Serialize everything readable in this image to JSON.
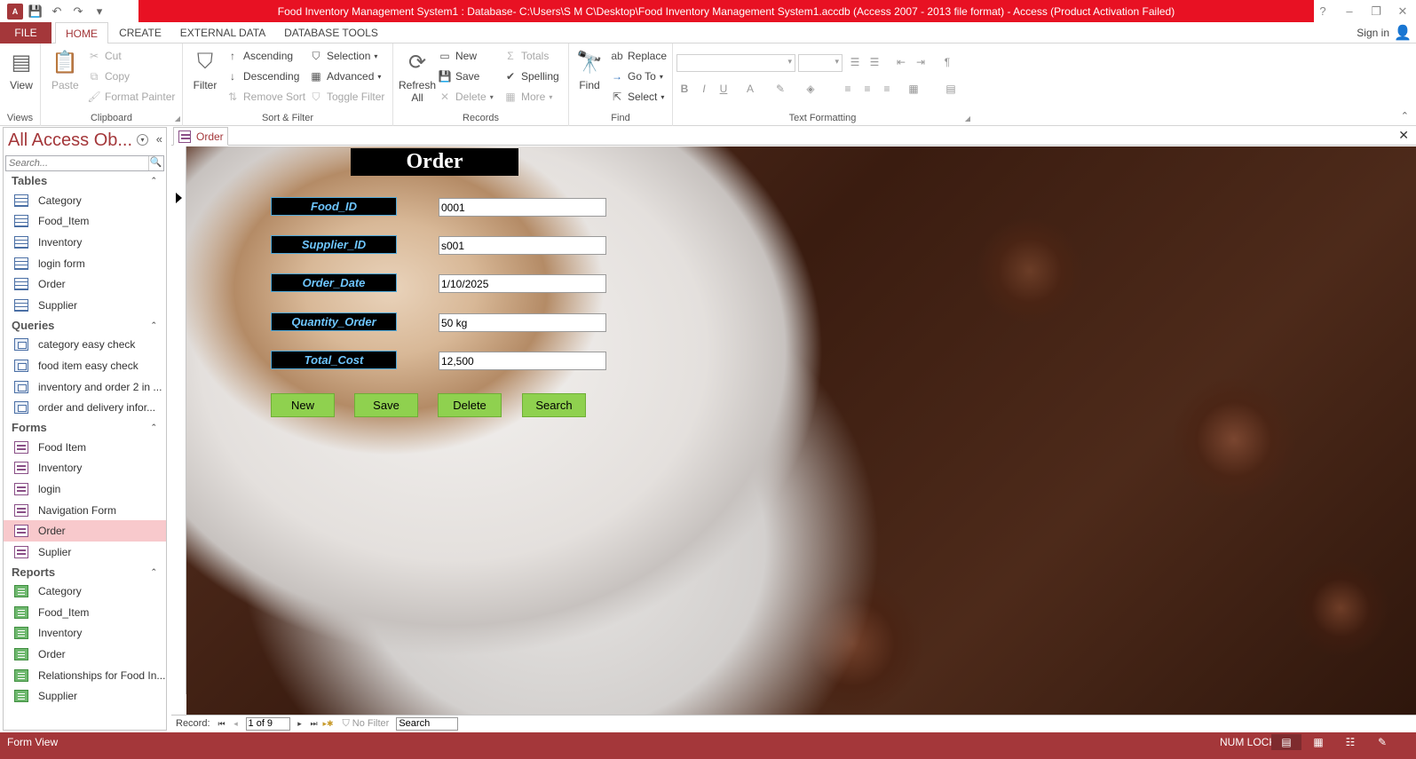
{
  "window": {
    "title": "Food Inventory Management System1 : Database- C:\\Users\\S M C\\Desktop\\Food Inventory Management System1.accdb (Access 2007 - 2013 file format) - Access (Product Activation Failed)",
    "app_logo_text": "A",
    "controls": {
      "help": "?",
      "minimize": "–",
      "restore": "❐",
      "close": "✕"
    }
  },
  "ribbon_tabs": {
    "file": "FILE",
    "home": "HOME",
    "create": "CREATE",
    "external_data": "EXTERNAL DATA",
    "database_tools": "DATABASE TOOLS",
    "sign_in": "Sign in"
  },
  "ribbon": {
    "views": {
      "label": "Views",
      "view": "View"
    },
    "clipboard": {
      "label": "Clipboard",
      "paste": "Paste",
      "cut": "Cut",
      "copy": "Copy",
      "format_painter": "Format Painter"
    },
    "sort_filter": {
      "label": "Sort & Filter",
      "filter": "Filter",
      "ascending": "Ascending",
      "descending": "Descending",
      "remove_sort": "Remove Sort",
      "selection": "Selection",
      "advanced": "Advanced",
      "toggle_filter": "Toggle Filter"
    },
    "records": {
      "label": "Records",
      "refresh": "Refresh",
      "refresh_all": "All",
      "new": "New",
      "save": "Save",
      "delete": "Delete",
      "totals": "Totals",
      "spelling": "Spelling",
      "more": "More"
    },
    "find": {
      "label": "Find",
      "find": "Find",
      "replace": "Replace",
      "go_to": "Go To",
      "select": "Select"
    },
    "text_formatting": {
      "label": "Text Formatting",
      "bold": "B",
      "italic": "I",
      "underline": "U",
      "font_color": "A"
    }
  },
  "nav_pane": {
    "title": "All Access Ob...",
    "search_placeholder": "Search...",
    "categories": [
      {
        "name": "Tables",
        "icon": "table",
        "items": [
          "Category",
          "Food_Item",
          "Inventory",
          "login form",
          "Order",
          "Supplier"
        ]
      },
      {
        "name": "Queries",
        "icon": "query",
        "items": [
          "category easy check",
          "food item easy check",
          "inventory and order 2 in ...",
          "order and delivery infor..."
        ]
      },
      {
        "name": "Forms",
        "icon": "form",
        "items": [
          "Food Item",
          "Inventory",
          "login",
          "Navigation Form",
          "Order",
          "Suplier"
        ]
      },
      {
        "name": "Reports",
        "icon": "report",
        "items": [
          "Category",
          "Food_Item",
          "Inventory",
          "Order",
          "Relationships for Food In...",
          "Supplier"
        ]
      }
    ],
    "selected": {
      "category": "Forms",
      "item": "Order"
    }
  },
  "document_tab": {
    "label": "Order"
  },
  "form": {
    "title": "Order",
    "fields": [
      {
        "label": "Food_ID",
        "value": "0001"
      },
      {
        "label": "Supplier_ID",
        "value": "s001"
      },
      {
        "label": "Order_Date",
        "value": "1/10/2025"
      },
      {
        "label": "Quantity_Order",
        "value": "50 kg"
      },
      {
        "label": "Total_Cost",
        "value": "12,500"
      }
    ],
    "buttons": {
      "new": "New",
      "save": "Save",
      "delete": "Delete",
      "search": "Search"
    },
    "label_color": "#6ec6ff",
    "button_color": "#8fd14f"
  },
  "record_nav": {
    "label": "Record:",
    "current": "1 of 9",
    "no_filter": "No Filter",
    "search_value": "Search"
  },
  "status_bar": {
    "view": "Form View",
    "num_lock": "NUM LOCK"
  },
  "colors": {
    "accent": "#a4373a",
    "title_bar": "#e81123",
    "selected_item": "#f8c9cc"
  }
}
